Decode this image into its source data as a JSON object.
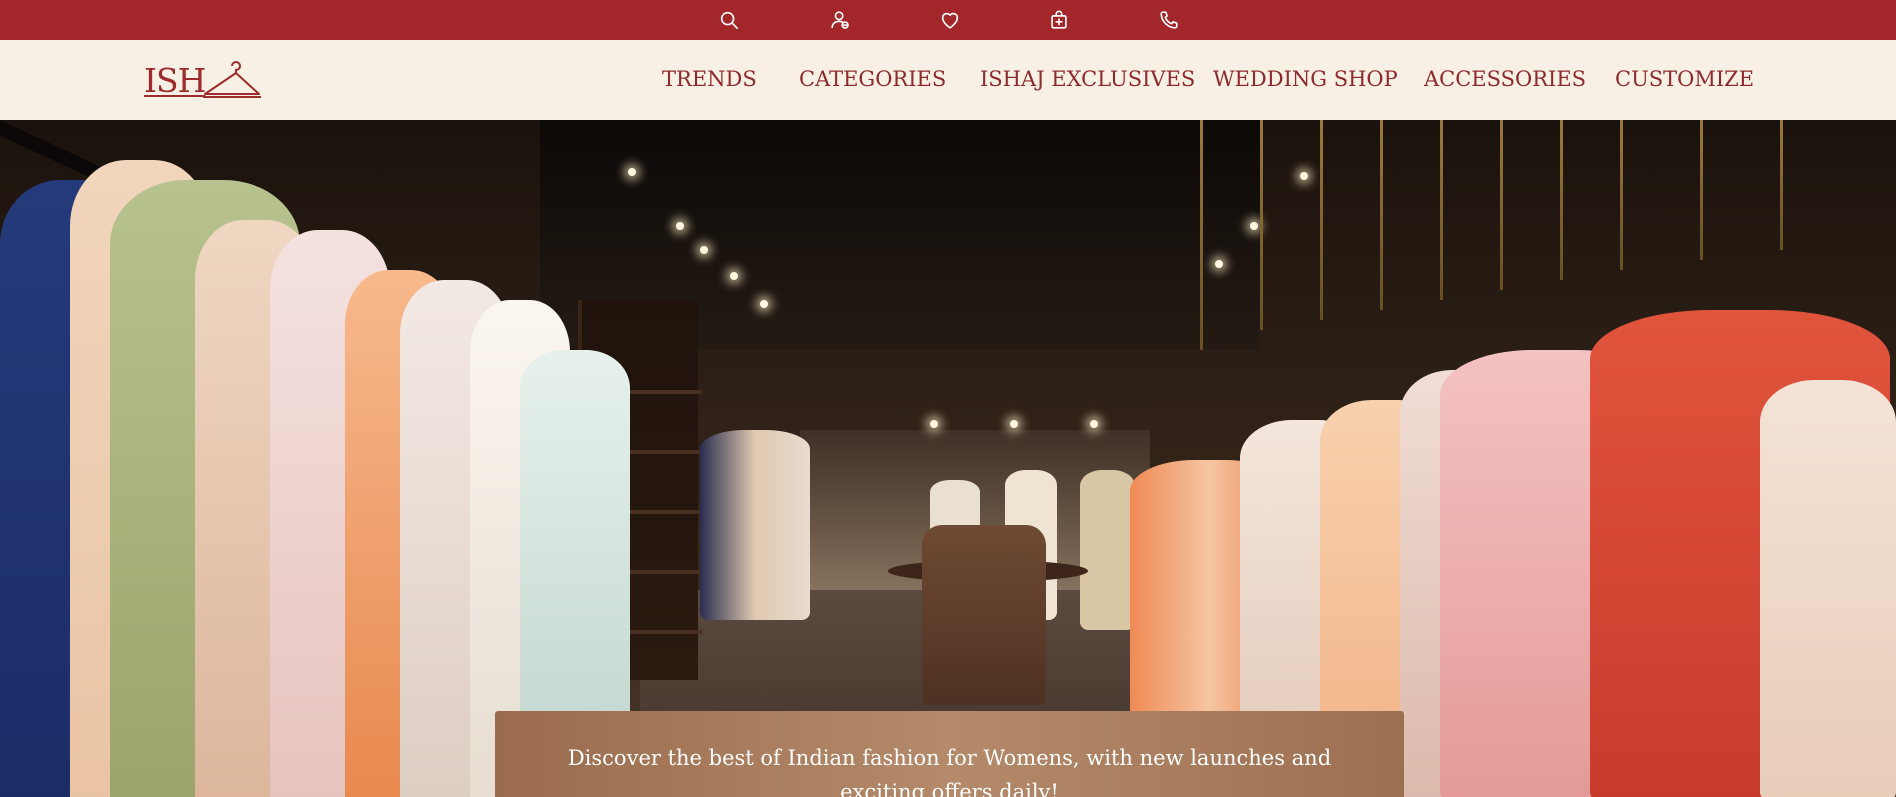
{
  "topbar": {
    "icons": [
      "search-icon",
      "account-icon",
      "wishlist-icon",
      "bag-icon",
      "phone-icon"
    ],
    "color": "#a3262a"
  },
  "logo": {
    "text": "ISH"
  },
  "nav": {
    "items": [
      "TRENDS",
      "CATEGORIES",
      "ISHAJ EXCLUSIVES",
      "WEDDING SHOP",
      "ACCESSORIES",
      "CUSTOMIZE"
    ],
    "background": "#f8f0e4",
    "text_color": "#8e2a2d"
  },
  "hero": {
    "caption": "Discover the best of Indian fashion for Womens, with new launches and exciting offers daily!"
  }
}
